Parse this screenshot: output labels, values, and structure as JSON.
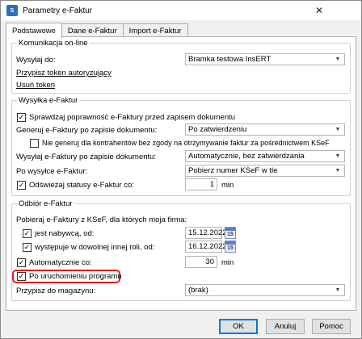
{
  "window": {
    "title": "Parametry e-Faktur",
    "icon": "app-icon"
  },
  "tabs": [
    "Podstawowe",
    "Dane e-Faktur",
    "Import e-Faktur"
  ],
  "komunikacja": {
    "legend": "Komunikacja on-line",
    "wysylaj_label": "Wysyłaj do:",
    "wysylaj_value": "Bramka testowa InsERT",
    "przypisz_link": "Przypisz token autoryzujący",
    "usun_link": "Usuń token"
  },
  "wysylka": {
    "legend": "Wysyłka e-Faktur",
    "sprawdzaj_label": "Sprawdzaj poprawność e-Faktury przed zapisem dokumentu",
    "sprawdzaj_checked": true,
    "generuj_label": "Generuj e-Faktury po zapisie dokumentu:",
    "generuj_value": "Po zatwierdzeniu",
    "nie_generuj_label": "Nie generuj dla kontrahentów bez zgody na otrzymywanie faktur za pośrednictwem KSeF",
    "nie_generuj_checked": false,
    "wysylaj_label": "Wysyłaj e-Faktury po zapisie dokumentu:",
    "wysylaj_value": "Automatycznie, bez zatwierdzania",
    "po_wysylce_label": "Po wysyłce e-Faktur:",
    "po_wysylce_value": "Pobierz numer KSeF w tle",
    "odswiezaj_label": "Odświeżaj statusy e-Faktur co:",
    "odswiezaj_checked": true,
    "odswiezaj_value": "1",
    "odswiezaj_unit": "min"
  },
  "odbior": {
    "legend": "Odbiór e-Faktur",
    "intro": "Pobieraj e-Faktury z KSeF, dla których moja firma:",
    "nabywca_label": "jest nabywcą, od:",
    "nabywca_checked": true,
    "nabywca_date": "15.12.2022",
    "inna_rola_label": "występuje w dowolnej innej roli, od:",
    "inna_rola_checked": true,
    "inna_rola_date": "16.12.2022",
    "calendar_day": "15",
    "automatycznie_label": "Automatycznie co:",
    "automatycznie_checked": true,
    "automatycznie_value": "30",
    "automatycznie_unit": "min",
    "po_uruchomieniu_label": "Po uruchomieniu programu",
    "po_uruchomieniu_checked": true,
    "magazyn_label": "Przypisz do magazynu:",
    "magazyn_value": "(brak)"
  },
  "buttons": {
    "ok": "OK",
    "anuluj": "Anuluj",
    "pomoc": "Pomoc"
  },
  "colors": {
    "highlight": "#e01e1e",
    "default_button_border": "#0078d7"
  }
}
